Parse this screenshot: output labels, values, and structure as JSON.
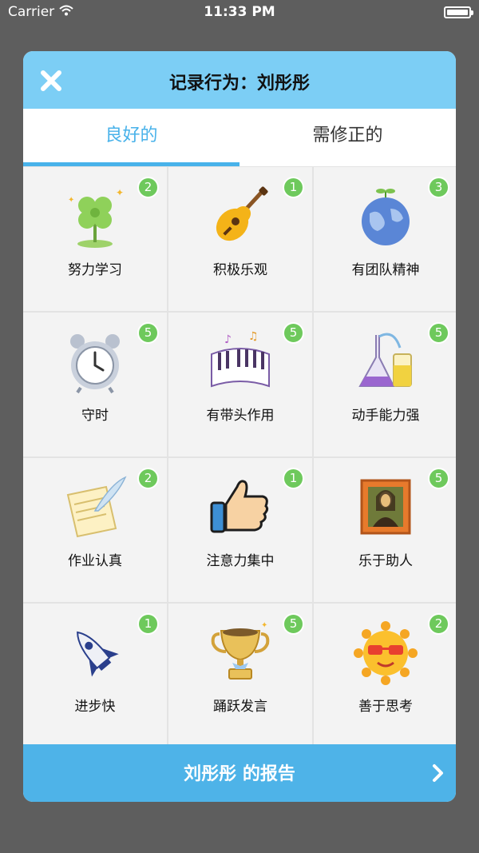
{
  "status_bar": {
    "carrier": "Carrier",
    "time": "11:33 PM"
  },
  "dialog": {
    "title": "记录行为：刘彤彤",
    "close_icon": "close-icon",
    "tabs": [
      {
        "label": "良好的",
        "active": true
      },
      {
        "label": "需修正的",
        "active": false
      }
    ],
    "behaviors": [
      {
        "label": "努力学习",
        "count": "2",
        "icon": "clover-icon"
      },
      {
        "label": "积极乐观",
        "count": "1",
        "icon": "guitar-icon"
      },
      {
        "label": "有团队精神",
        "count": "3",
        "icon": "globe-icon"
      },
      {
        "label": "守时",
        "count": "5",
        "icon": "alarm-clock-icon"
      },
      {
        "label": "有带头作用",
        "count": "5",
        "icon": "piano-icon"
      },
      {
        "label": "动手能力强",
        "count": "5",
        "icon": "lab-flask-icon"
      },
      {
        "label": "作业认真",
        "count": "2",
        "icon": "paper-quill-icon"
      },
      {
        "label": "注意力集中",
        "count": "1",
        "icon": "thumbs-up-icon"
      },
      {
        "label": "乐于助人",
        "count": "5",
        "icon": "mona-lisa-icon"
      },
      {
        "label": "进步快",
        "count": "1",
        "icon": "rocket-icon"
      },
      {
        "label": "踊跃发言",
        "count": "5",
        "icon": "trophy-icon"
      },
      {
        "label": "善于思考",
        "count": "2",
        "icon": "sun-icon"
      }
    ],
    "report_label": "刘彤彤 的报告"
  },
  "colors": {
    "header": "#7ccef5",
    "accent": "#48b2ea",
    "badge": "#6ec95c",
    "report_bar": "#4eb3e8"
  }
}
